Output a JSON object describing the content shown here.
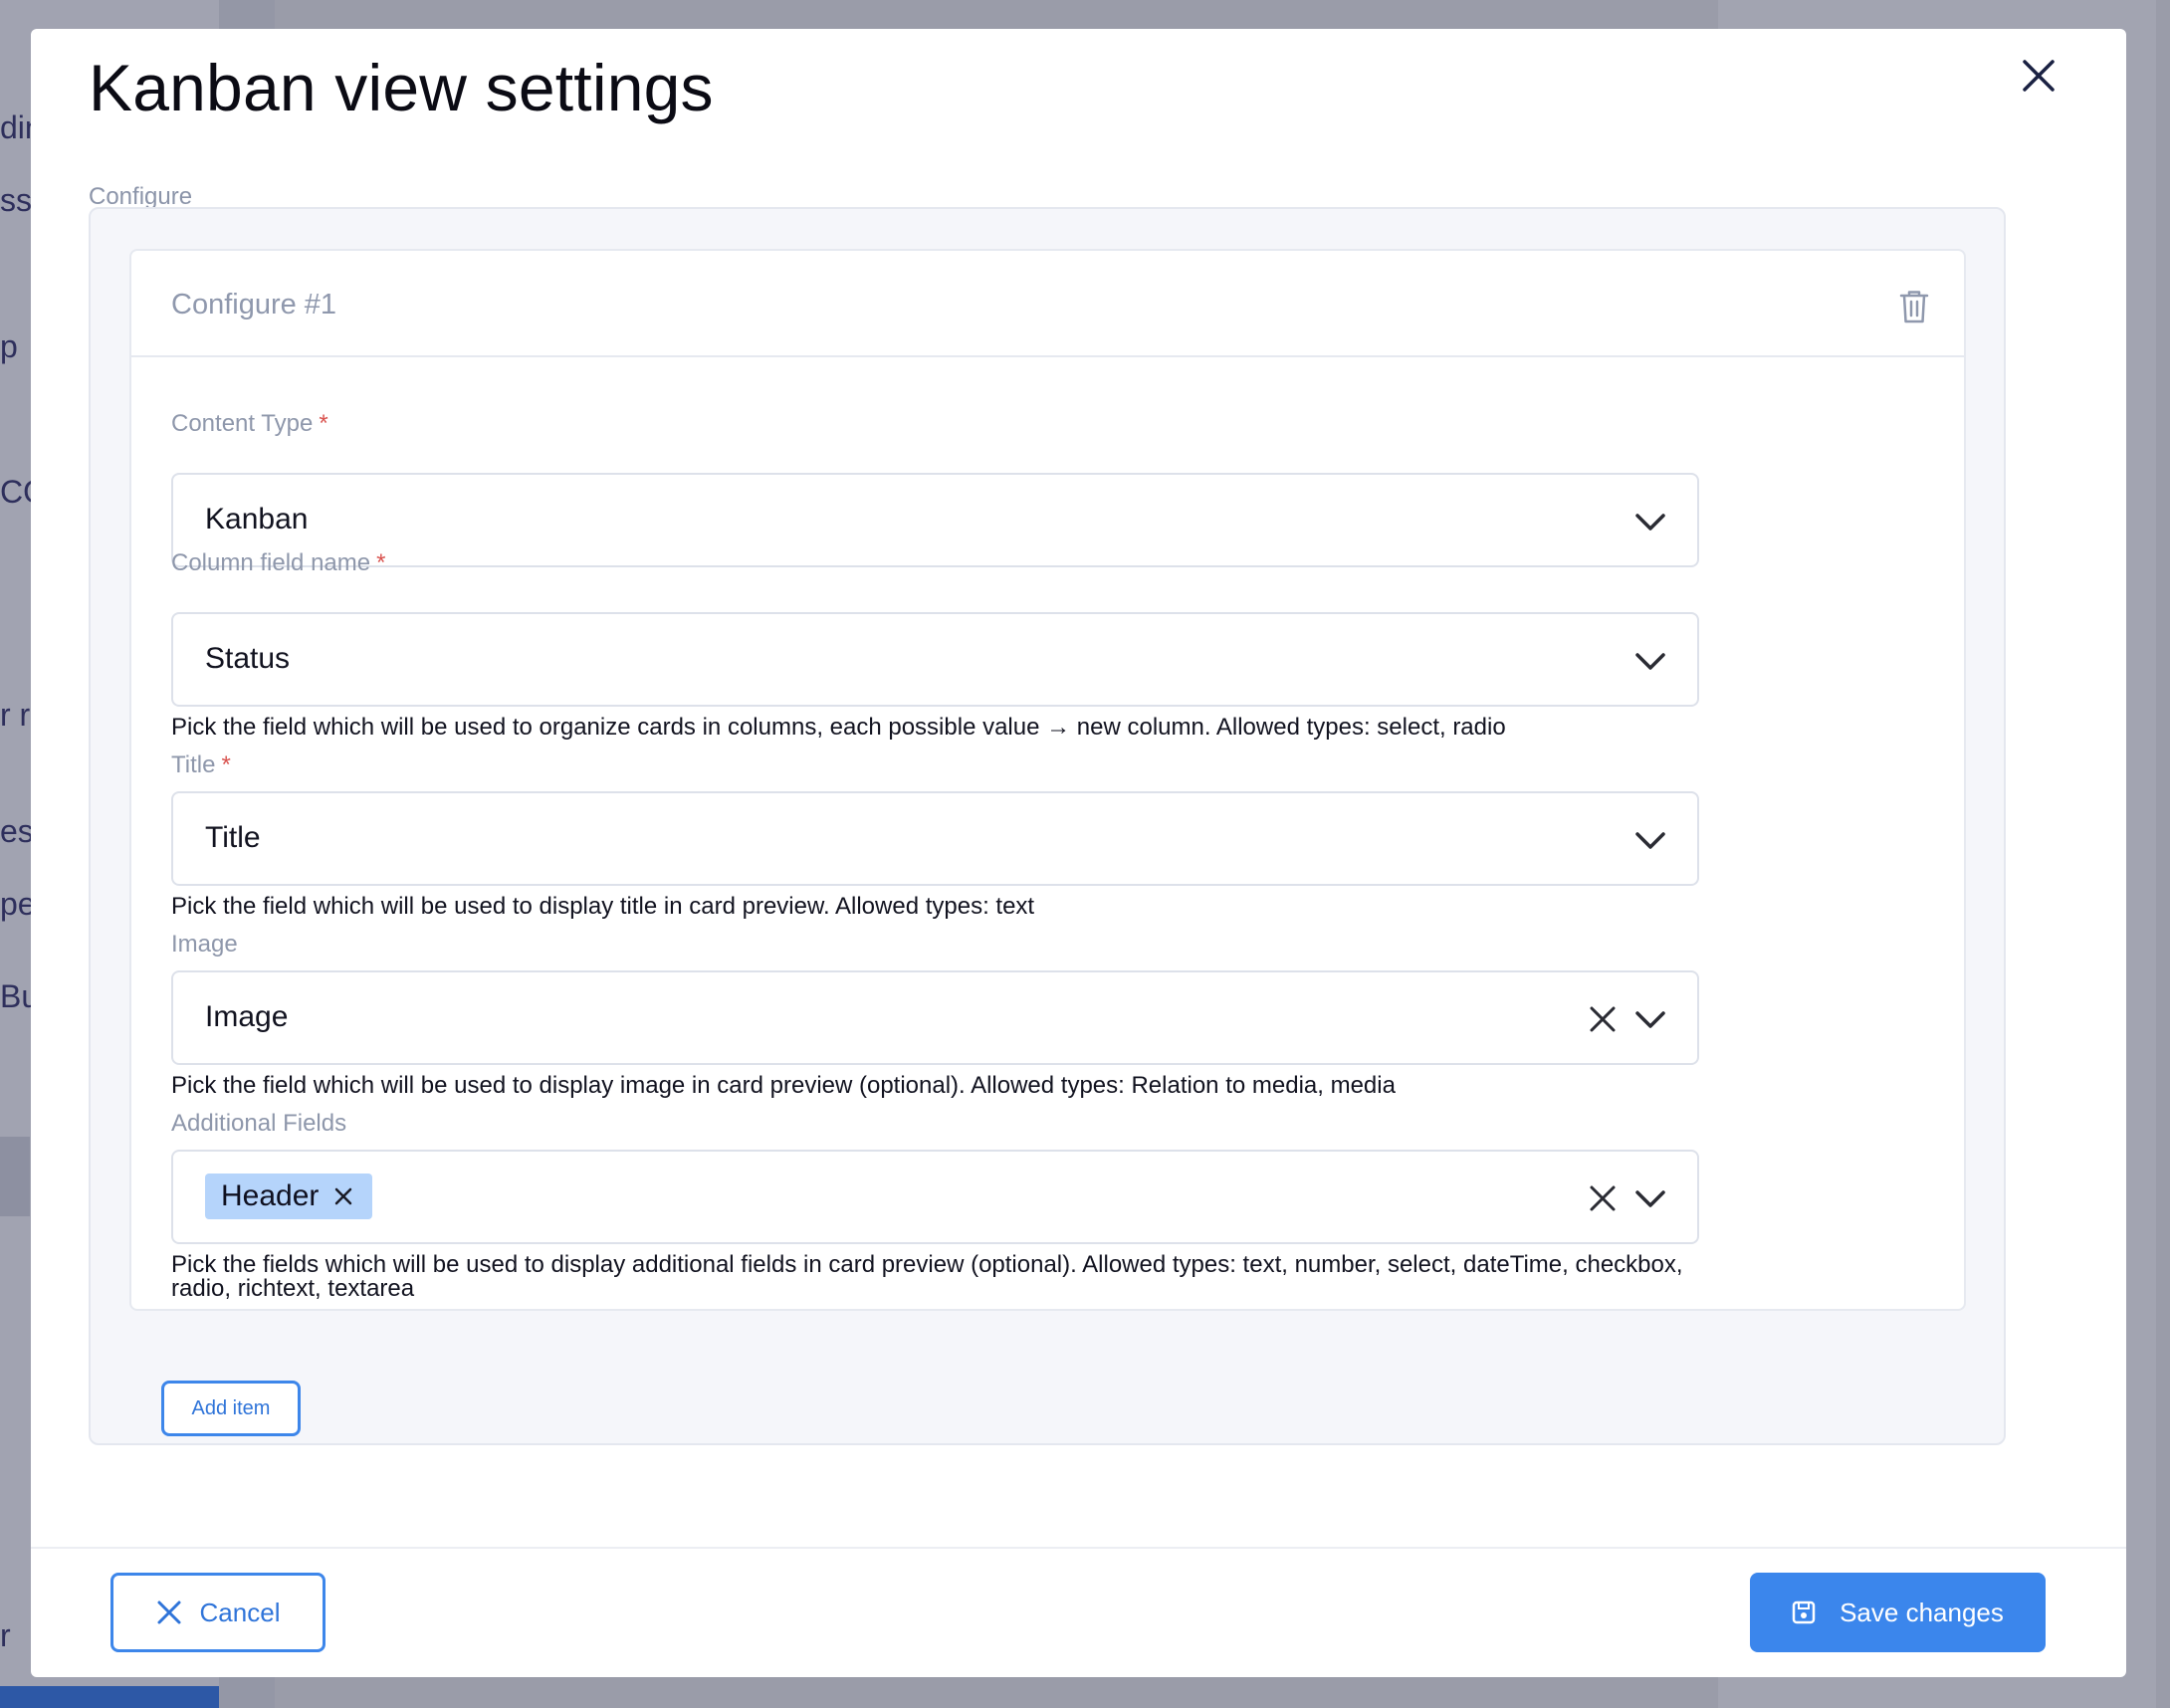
{
  "background": {
    "fragments": [
      "din",
      "ssn",
      "p",
      "CO",
      "r re",
      "esa",
      "pe",
      "Bui",
      "r"
    ]
  },
  "modal": {
    "title": "Kanban view settings",
    "section_label": "Configure",
    "card": {
      "title": "Configure #1",
      "fields": {
        "content_type": {
          "label": "Content Type",
          "required_mark": "*",
          "value": "Kanban"
        },
        "column_field": {
          "label": "Column field name",
          "required_mark": "*",
          "value": "Status",
          "hint": "Pick the field which will be used to organize cards in columns, each possible value → new column. Allowed types: select, radio"
        },
        "title_field": {
          "label": "Title",
          "required_mark": "*",
          "value": "Title",
          "hint": "Pick the field which will be used to display title in card preview. Allowed types: text"
        },
        "image_field": {
          "label": "Image",
          "value": "Image",
          "hint": "Pick the field which will be used to display image in card preview (optional). Allowed types: Relation to media, media"
        },
        "additional_fields": {
          "label": "Additional Fields",
          "chips": [
            "Header"
          ],
          "hint": "Pick the fields which will be used to display additional fields in card preview (optional). Allowed types: text, number, select, dateTime, checkbox, radio, richtext, textarea"
        }
      }
    },
    "add_item_label": "Add item",
    "footer": {
      "cancel_label": "Cancel",
      "save_label": "Save changes"
    }
  },
  "colors": {
    "accent": "#3b86ec",
    "chip_bg": "#b5d4fb",
    "required": "#d9534f",
    "muted_label": "#8e97ab"
  },
  "icons": [
    "close-icon",
    "trash-icon",
    "chevron-down-icon",
    "clear-icon",
    "save-icon"
  ]
}
